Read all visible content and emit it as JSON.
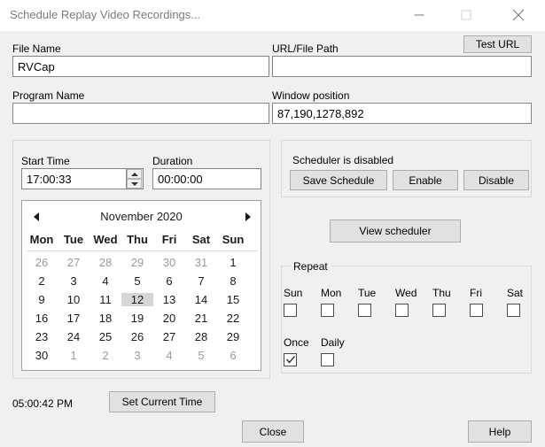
{
  "window": {
    "title": "Schedule Replay Video Recordings...",
    "controls": {
      "minimize": "minimize-icon",
      "maximize": "maximize-icon",
      "close": "close-icon"
    }
  },
  "form": {
    "file_name_label": "File Name",
    "file_name_value": "RVCap",
    "url_path_label": "URL/File Path",
    "url_path_value": "",
    "test_url_button": "Test URL",
    "program_name_label": "Program Name",
    "program_name_value": "",
    "window_position_label": "Window position",
    "window_position_value": "87,190,1278,892"
  },
  "schedule_panel": {
    "start_time_label": "Start Time",
    "start_time_value": "17:00:33",
    "duration_label": "Duration",
    "duration_value": "00:00:00",
    "spinner_up": "spin-up-icon",
    "spinner_down": "spin-down-icon"
  },
  "calendar": {
    "prev_label": "chevron-left-icon",
    "next_label": "chevron-right-icon",
    "month_year": "November 2020",
    "weekdays": [
      "Mon",
      "Tue",
      "Wed",
      "Thu",
      "Fri",
      "Sat",
      "Sun"
    ],
    "selected_day": 12,
    "weeks": [
      [
        {
          "d": "26",
          "other": true
        },
        {
          "d": "27",
          "other": true
        },
        {
          "d": "28",
          "other": true
        },
        {
          "d": "29",
          "other": true
        },
        {
          "d": "30",
          "other": true
        },
        {
          "d": "31",
          "other": true
        },
        {
          "d": "1",
          "other": false
        }
      ],
      [
        {
          "d": "2",
          "other": false
        },
        {
          "d": "3",
          "other": false
        },
        {
          "d": "4",
          "other": false
        },
        {
          "d": "5",
          "other": false
        },
        {
          "d": "6",
          "other": false
        },
        {
          "d": "7",
          "other": false
        },
        {
          "d": "8",
          "other": false
        }
      ],
      [
        {
          "d": "9",
          "other": false
        },
        {
          "d": "10",
          "other": false
        },
        {
          "d": "11",
          "other": false
        },
        {
          "d": "12",
          "other": false,
          "selected": true
        },
        {
          "d": "13",
          "other": false
        },
        {
          "d": "14",
          "other": false
        },
        {
          "d": "15",
          "other": false
        }
      ],
      [
        {
          "d": "16",
          "other": false
        },
        {
          "d": "17",
          "other": false
        },
        {
          "d": "18",
          "other": false
        },
        {
          "d": "19",
          "other": false
        },
        {
          "d": "20",
          "other": false
        },
        {
          "d": "21",
          "other": false
        },
        {
          "d": "22",
          "other": false
        }
      ],
      [
        {
          "d": "23",
          "other": false
        },
        {
          "d": "24",
          "other": false
        },
        {
          "d": "25",
          "other": false
        },
        {
          "d": "26",
          "other": false
        },
        {
          "d": "27",
          "other": false
        },
        {
          "d": "28",
          "other": false
        },
        {
          "d": "29",
          "other": false
        }
      ],
      [
        {
          "d": "30",
          "other": false
        },
        {
          "d": "1",
          "other": true
        },
        {
          "d": "2",
          "other": true
        },
        {
          "d": "3",
          "other": true
        },
        {
          "d": "4",
          "other": true
        },
        {
          "d": "5",
          "other": true
        },
        {
          "d": "6",
          "other": true
        }
      ]
    ]
  },
  "scheduler": {
    "status": "Scheduler is disabled",
    "save_button": "Save Schedule",
    "enable_button": "Enable",
    "disable_button": "Disable",
    "view_button": "View scheduler"
  },
  "repeat": {
    "title": "Repeat",
    "days": [
      {
        "label": "Sun",
        "checked": false
      },
      {
        "label": "Mon",
        "checked": false
      },
      {
        "label": "Tue",
        "checked": false
      },
      {
        "label": "Wed",
        "checked": false
      },
      {
        "label": "Thu",
        "checked": false
      },
      {
        "label": "Fri",
        "checked": false
      },
      {
        "label": "Sat",
        "checked": false
      }
    ],
    "modes": [
      {
        "label": "Once",
        "checked": true
      },
      {
        "label": "Daily",
        "checked": false
      }
    ]
  },
  "footer": {
    "current_time": "05:00:42 PM",
    "set_current_time_button": "Set Current Time",
    "close_button": "Close",
    "help_button": "Help"
  }
}
